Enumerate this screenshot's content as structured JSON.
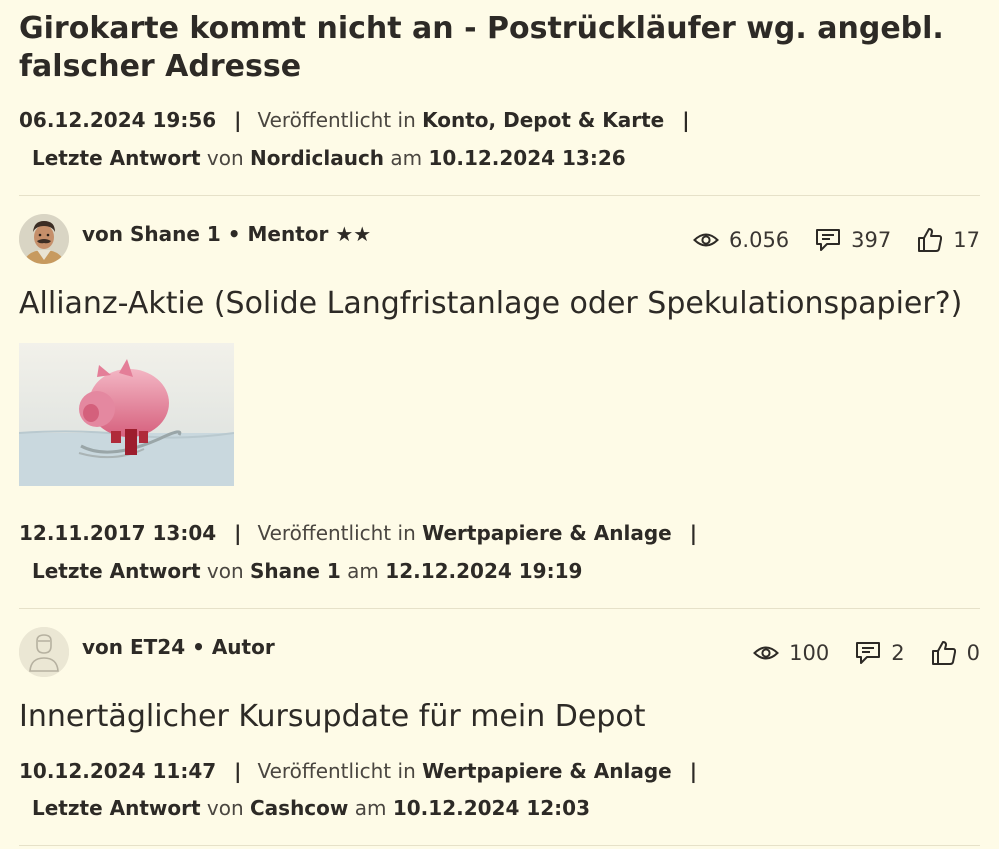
{
  "topic1": {
    "title": "Girokarte kommt nicht an - Postrückläufer wg. angebl. falscher Adresse",
    "date": "06.12.2024 19:56",
    "published_prefix": "Veröffentlicht in",
    "board": "Konto, Depot & Karte",
    "last_reply_label": "Letzte Antwort",
    "von": "von",
    "last_reply_user": "Nordiclauch",
    "am": "am",
    "last_reply_date": "10.12.2024 13:26"
  },
  "topic2": {
    "author_line": "von Shane 1 • Mentor ★★",
    "views": "6.056",
    "replies": "397",
    "likes": "17",
    "title": "Allianz-Aktie (Solide Langfristanlage oder Spekulationspapier?)",
    "date": "12.11.2017 13:04",
    "published_prefix": "Veröffentlicht in",
    "board": "Wertpapiere & Anlage",
    "last_reply_label": "Letzte Antwort",
    "von": "von",
    "last_reply_user": "Shane 1",
    "am": "am",
    "last_reply_date": "12.12.2024 19:19"
  },
  "topic3": {
    "author_line": "von ET24 • Autor",
    "views": "100",
    "replies": "2",
    "likes": "0",
    "title": "Innertäglicher Kursupdate für mein Depot",
    "date": "10.12.2024 11:47",
    "published_prefix": "Veröffentlicht in",
    "board": "Wertpapiere & Anlage",
    "last_reply_label": "Letzte Antwort",
    "von": "von",
    "last_reply_user": "Cashcow",
    "am": "am",
    "last_reply_date": "10.12.2024 12:03"
  },
  "separator": "|",
  "icons": {
    "views": "eye-icon",
    "replies": "comment-icon",
    "likes": "thumbs-up-icon"
  },
  "colors": {
    "background": "#fefbe7",
    "text": "#2d2a26",
    "divider": "#e6e1c9"
  }
}
